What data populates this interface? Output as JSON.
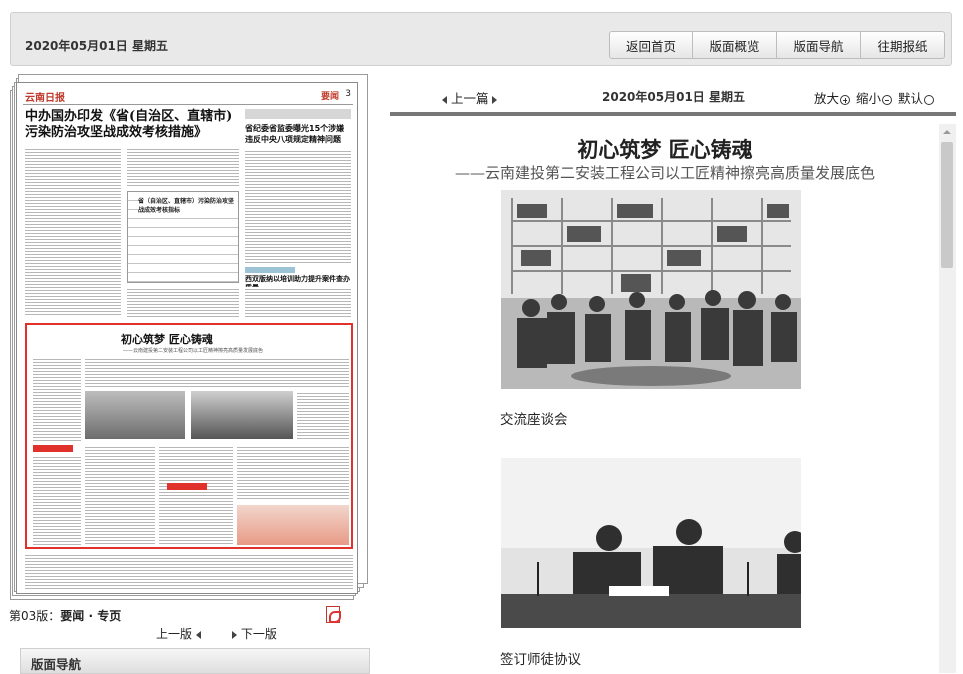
{
  "header": {
    "date": "2020年05月01日 星期五",
    "nav": [
      "返回首页",
      "版面概览",
      "版面导航",
      "往期报纸"
    ]
  },
  "thumbnail": {
    "logo": "云南日报",
    "section_tag": "要闻",
    "page_no": "3",
    "headline_main": "中办国办印发《省(自治区、直辖市)污染防治攻坚战成效考核措施》",
    "headline_right": "省纪委省监委曝光15个涉嫌违反中央八项规定精神问题",
    "headline_right2": "西双版纳以培训助力提升案件查办质量",
    "table_title": "省（自治区、直辖市）污染防治攻坚战成效考核指标",
    "red_box_title": "初心筑梦 匠心铸魂",
    "red_box_subtitle": "——云南建投第二安装工程公司以工匠精神擦亮高质量发展底色"
  },
  "page_info": {
    "prefix": "第03版：",
    "name": "要闻 · 专页",
    "prev_page": "上一版",
    "next_page": "下一版"
  },
  "version_nav": {
    "title": "版面导航"
  },
  "toolbar": {
    "prev_article": "上一篇",
    "date": "2020年05月01日 星期五",
    "zoom_in": "放大",
    "zoom_out": "缩小",
    "default": "默认"
  },
  "article": {
    "title": "初心筑梦 匠心铸魂",
    "subtitle": "——云南建投第二安装工程公司以工匠精神擦亮高质量发展底色",
    "photos": [
      {
        "caption": "交流座谈会"
      },
      {
        "caption": "签订师徒协议"
      }
    ]
  }
}
